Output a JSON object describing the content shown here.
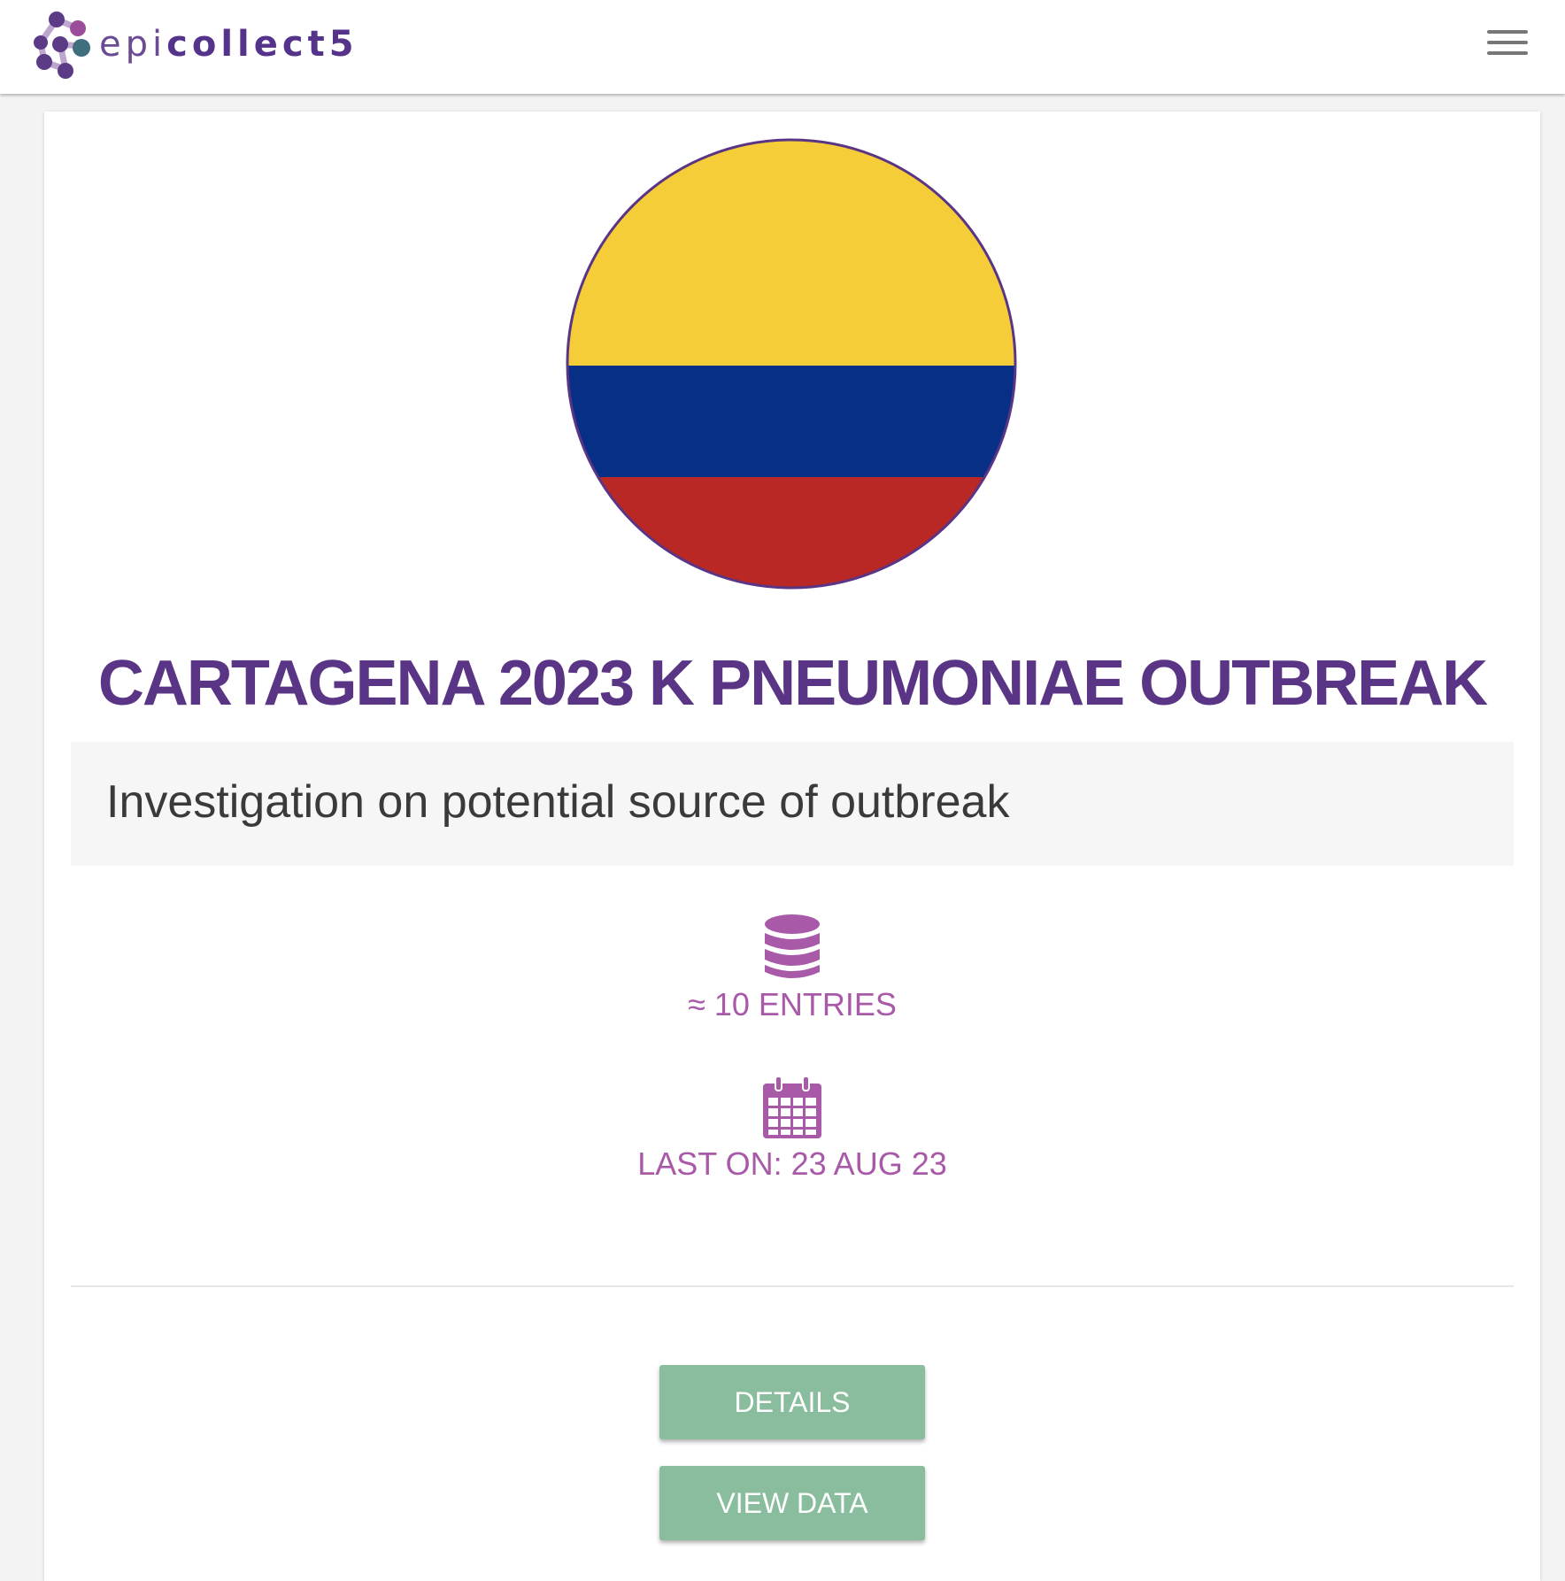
{
  "navbar": {
    "brand_prefix": "epi",
    "brand_suffix": "collect5",
    "menu_icon": "hamburger-menu-icon"
  },
  "project": {
    "logo_icon": "colombia-flag-logo",
    "title": "CARTAGENA 2023 K PNEUMONIAE OUTBREAK",
    "description": "Investigation on potential source of outbreak",
    "entries_icon": "database-icon",
    "entries_text": "≈ 10 ENTRIES",
    "last_icon": "calendar-icon",
    "last_text": "LAST ON: 23 AUG 23"
  },
  "actions": {
    "details_label": "Details",
    "view_data_label": "View data"
  },
  "colors": {
    "brand_purple": "#5b3585",
    "stat_magenta": "#a85aa8",
    "button_green": "#89bd9e",
    "flag_yellow": "#f5cd38",
    "flag_blue": "#072f86",
    "flag_red": "#b92824"
  }
}
